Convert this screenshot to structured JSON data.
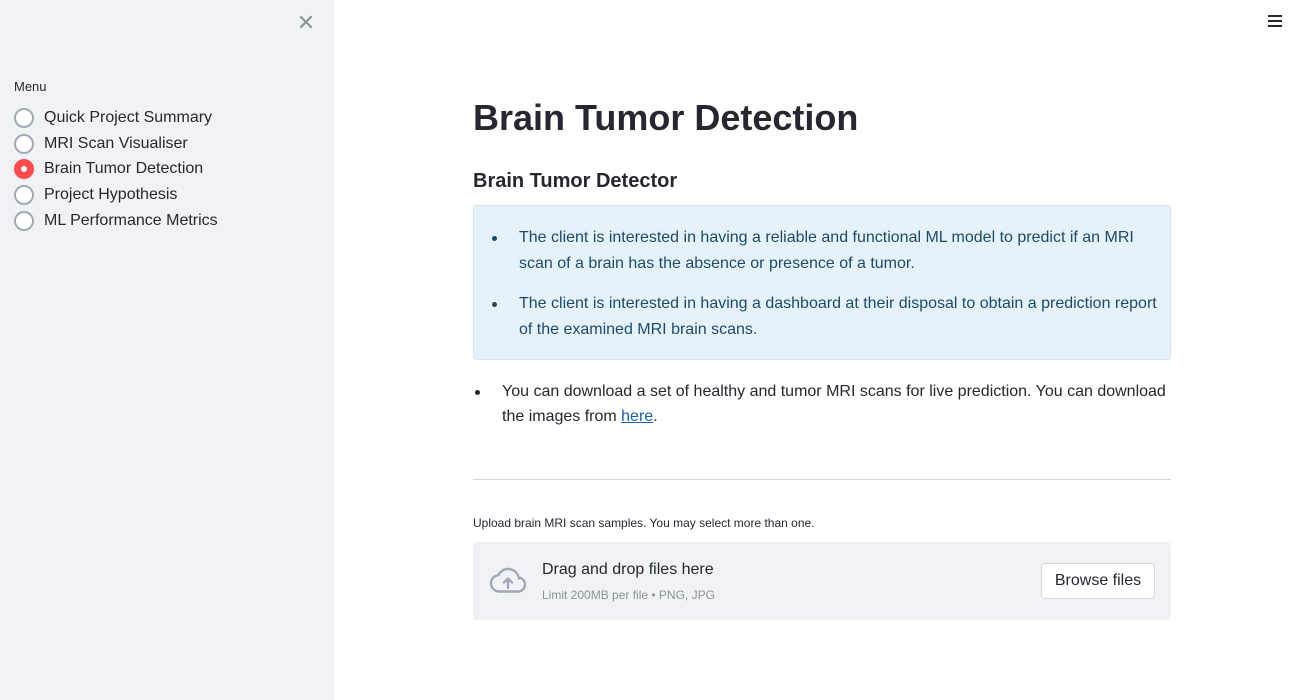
{
  "sidebar": {
    "menu_label": "Menu",
    "close_symbol": "✕",
    "items": [
      {
        "label": "Quick Project Summary",
        "selected": false
      },
      {
        "label": "MRI Scan Visualiser",
        "selected": false
      },
      {
        "label": "Brain Tumor Detection",
        "selected": true
      },
      {
        "label": "Project Hypothesis",
        "selected": false
      },
      {
        "label": "ML Performance Metrics",
        "selected": false
      }
    ]
  },
  "main": {
    "title": "Brain Tumor Detection",
    "subheader": "Brain Tumor Detector",
    "info_bullets": [
      "The client is interested in having a reliable and functional ML model to predict if an MRI scan of a brain has the absence or presence of a tumor.",
      "The client is interested in having a dashboard at their disposal to obtain a prediction report of the examined MRI brain scans."
    ],
    "download_text": "You can download a set of healthy and tumor MRI scans for live prediction. You can download the images from ",
    "download_link": "here",
    "download_suffix": ".",
    "uploader": {
      "label": "Upload brain MRI scan samples. You may select more than one.",
      "drop_title": "Drag and drop files here",
      "drop_sub": "Limit 200MB per file • PNG, JPG",
      "browse_label": "Browse files"
    }
  },
  "colors": {
    "accent": "#ff4b4b",
    "sidebar_bg": "#f0f2f6",
    "info_bg": "#e6f2fb",
    "info_text": "#1d4a6a",
    "link": "#1a5fb4"
  },
  "icons": {
    "close": "close-icon",
    "menu": "hamburger-menu-icon",
    "upload": "cloud-upload-icon"
  }
}
